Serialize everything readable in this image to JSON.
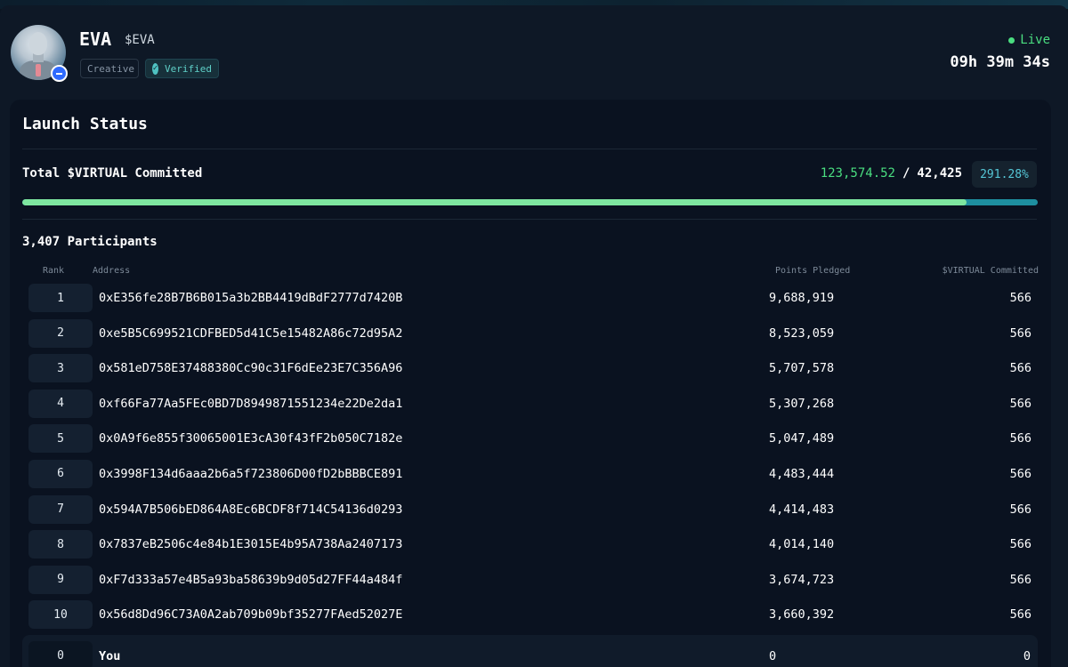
{
  "token": {
    "name": "EVA",
    "ticker": "$EVA",
    "tags": [
      "Creative",
      "Verified"
    ],
    "status": "Live",
    "countdown": "09h 39m 34s",
    "avatar": "robot-avatar-icon",
    "chain_badge": "base-chain-icon"
  },
  "launch": {
    "title": "Launch Status",
    "committed_label": "Total $VIRTUAL Committed",
    "committed_value": "123,574.52",
    "separator": "/",
    "goal_value": "42,425",
    "percent": "291.28%",
    "progress_fraction": 0.93
  },
  "participants": {
    "count_label": "3,407 Participants",
    "columns": {
      "rank": "Rank",
      "address": "Address",
      "points": "Points Pledged",
      "virtual": "$VIRTUAL Committed"
    },
    "rows": [
      {
        "rank": "1",
        "address": "0xE356fe28B7B6B015a3b2BB4419dBdF2777d7420B",
        "points": "9,688,919",
        "virtual": "566"
      },
      {
        "rank": "2",
        "address": "0xe5B5C699521CDFBED5d41C5e15482A86c72d95A2",
        "points": "8,523,059",
        "virtual": "566"
      },
      {
        "rank": "3",
        "address": "0x581eD758E37488380Cc90c31F6dEe23E7C356A96",
        "points": "5,707,578",
        "virtual": "566"
      },
      {
        "rank": "4",
        "address": "0xf66Fa77Aa5FEc0BD7D8949871551234e22De2da1",
        "points": "5,307,268",
        "virtual": "566"
      },
      {
        "rank": "5",
        "address": "0x0A9f6e855f30065001E3cA30f43fF2b050C7182e",
        "points": "5,047,489",
        "virtual": "566"
      },
      {
        "rank": "6",
        "address": "0x3998F134d6aaa2b6a5f723806D00fD2bBBBCE891",
        "points": "4,483,444",
        "virtual": "566"
      },
      {
        "rank": "7",
        "address": "0x594A7B506bED864A8Ec6BCDF8f714C54136d0293",
        "points": "4,414,483",
        "virtual": "566"
      },
      {
        "rank": "8",
        "address": "0x7837eB2506c4e84b1E3015E4b95A738Aa2407173",
        "points": "4,014,140",
        "virtual": "566"
      },
      {
        "rank": "9",
        "address": "0xF7d333a57e4B5a93ba58639b9d05d27FF44a484f",
        "points": "3,674,723",
        "virtual": "566"
      },
      {
        "rank": "10",
        "address": "0x56d8Dd96C73A0A2ab709b09bf35277FAed52027E",
        "points": "3,660,392",
        "virtual": "566"
      }
    ],
    "you": {
      "rank": "0",
      "address": "You",
      "points": "0",
      "virtual": "0"
    }
  },
  "colors": {
    "accent_green": "#4ade80",
    "accent_teal": "#55c6d6",
    "background": "#0b1521"
  }
}
